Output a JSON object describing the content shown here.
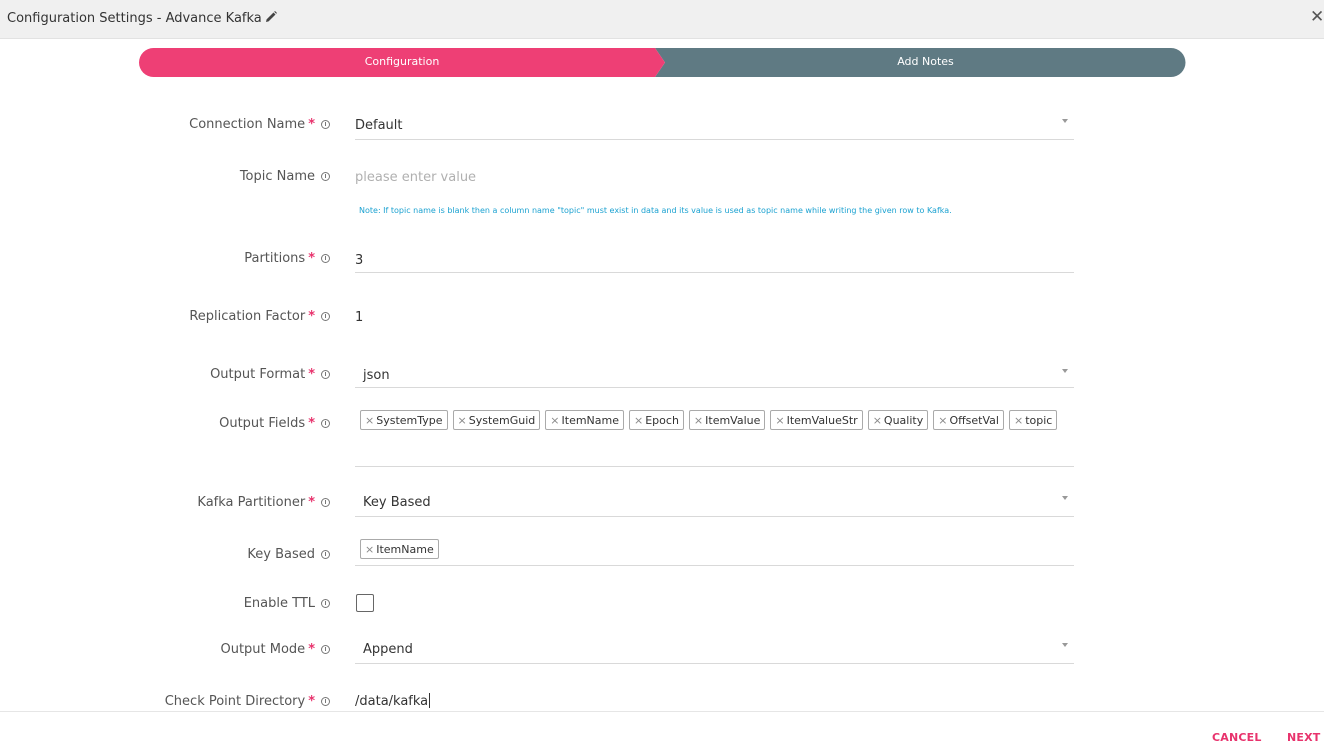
{
  "header": {
    "title": "Configuration Settings -  Advance Kafka",
    "close_symbol": "✕"
  },
  "stepper": {
    "steps": [
      {
        "label": "Configuration",
        "active": true
      },
      {
        "label": "Add Notes",
        "active": false
      }
    ]
  },
  "colors": {
    "accent": "#ee3f75",
    "inactive_step": "#5f7a83",
    "note": "#1ca2d1"
  },
  "form": {
    "connection_name": {
      "label": "Connection Name",
      "value": "Default"
    },
    "topic_name": {
      "label": "Topic Name",
      "placeholder": "please enter value",
      "note": "Note: If topic name is blank then a column name \"topic\" must exist in data and its value is used as topic name while writing the given row to Kafka."
    },
    "partitions": {
      "label": "Partitions",
      "value": "3"
    },
    "replication_factor": {
      "label": "Replication Factor",
      "value": "1"
    },
    "output_format": {
      "label": "Output Format",
      "value": "json"
    },
    "output_fields": {
      "label": "Output Fields",
      "tags": [
        "SystemType",
        "SystemGuid",
        "ItemName",
        "Epoch",
        "ItemValue",
        "ItemValueStr",
        "Quality",
        "OffsetVal",
        "topic"
      ]
    },
    "kafka_partitioner": {
      "label": "Kafka Partitioner",
      "value": "Key Based"
    },
    "key_based": {
      "label": "Key Based",
      "tags": [
        "ItemName"
      ]
    },
    "enable_ttl": {
      "label": "Enable TTL",
      "checked": false
    },
    "output_mode": {
      "label": "Output Mode",
      "value": "Append"
    },
    "checkpoint_directory": {
      "label": "Check Point Directory",
      "value": "/data/kafka"
    }
  },
  "footer": {
    "cancel_label": "CANCEL",
    "next_label": "NEXT"
  }
}
